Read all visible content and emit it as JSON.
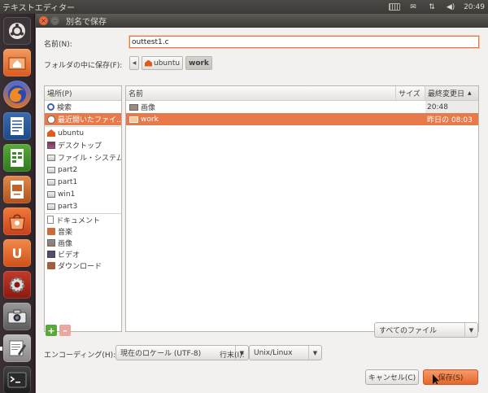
{
  "top_panel": {
    "app_title": "テキストエディター",
    "clock": "20:49",
    "indicators": [
      "keyboard-icon",
      "mail-icon",
      "network-icon",
      "volume-icon"
    ]
  },
  "launcher": {
    "items": [
      {
        "name": "dash-home",
        "icon": "ubuntu-logo-icon",
        "color": "#3b3b3b"
      },
      {
        "name": "home-folder",
        "icon": "home-folder-icon",
        "color": "#e8743b"
      },
      {
        "name": "firefox",
        "icon": "firefox-icon",
        "color": "#e66a1a"
      },
      {
        "name": "writer",
        "icon": "writer-icon",
        "color": "#2e5a94"
      },
      {
        "name": "calc",
        "icon": "calc-icon",
        "color": "#3a8a2c"
      },
      {
        "name": "impress",
        "icon": "impress-icon",
        "color": "#c2622a"
      },
      {
        "name": "software-center",
        "icon": "software-center-icon",
        "color": "#d9501d"
      },
      {
        "name": "ubuntu-one",
        "icon": "ubuntu-one-icon",
        "color": "#e06a2a"
      },
      {
        "name": "system-settings",
        "icon": "settings-icon",
        "color": "#a52a1a"
      },
      {
        "name": "screenshot",
        "icon": "camera-icon",
        "color": "#6a6a6a"
      },
      {
        "name": "text-editor",
        "icon": "text-editor-icon",
        "color": "#8a8a8a"
      },
      {
        "name": "terminal",
        "icon": "terminal-icon",
        "color": "#2a2a2a"
      }
    ]
  },
  "dialog": {
    "title": "別名で保存",
    "name_label": "名前(N):",
    "name_value": "outtest1.c",
    "save_in_label": "フォルダの中に保存(F):",
    "breadcrumbs": [
      "ubuntu",
      "work"
    ],
    "places": {
      "header": "場所(P)",
      "group1": [
        "検索",
        "最近開いたファイ..."
      ],
      "group2": [
        "ubuntu",
        "デスクトップ",
        "ファイル・システム",
        "part2",
        "part1",
        "win1",
        "part3"
      ],
      "group3": [
        "ドキュメント",
        "音楽",
        "画像",
        "ビデオ",
        "ダウンロード"
      ]
    },
    "files": {
      "columns": [
        "名前",
        "サイズ",
        "最終変更日"
      ],
      "rows": [
        {
          "name": "画像",
          "size": "",
          "modified": "20:48"
        },
        {
          "name": "work",
          "size": "",
          "modified": "昨日の 08:03"
        }
      ]
    },
    "filter": "すべてのファイル",
    "encoding_label": "エンコーディング(H):",
    "encoding_value": "現在のロケール (UTF-8)",
    "line_end_label": "行末(I):",
    "line_end_value": "Unix/Linux",
    "cancel_label": "キャンセル(C)",
    "save_label": "保存(S)"
  }
}
